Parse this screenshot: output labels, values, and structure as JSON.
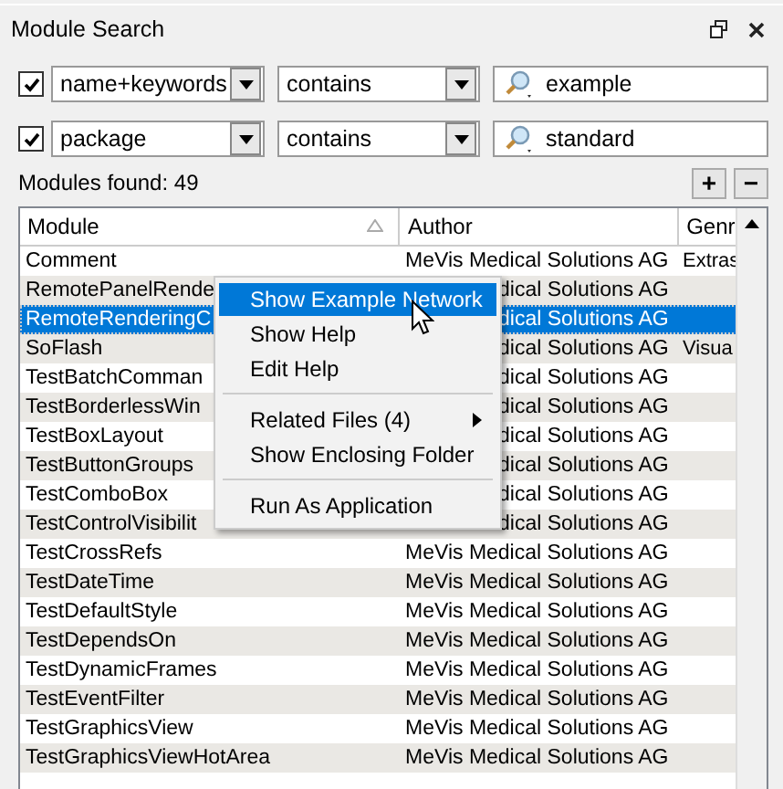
{
  "panel": {
    "title": "Module Search"
  },
  "filters": [
    {
      "checked": true,
      "field": "name+keywords",
      "operator": "contains",
      "value": "example"
    },
    {
      "checked": true,
      "field": "package",
      "operator": "contains",
      "value": "standard"
    }
  ],
  "result_count": "Modules found: 49",
  "buttons": [
    "+",
    "−"
  ],
  "table": {
    "columns": [
      {
        "label": "Module",
        "sorted": true
      },
      {
        "label": "Author",
        "sorted": false
      },
      {
        "label": "Genr",
        "sorted": false
      }
    ],
    "rows": [
      {
        "module": "Comment",
        "author": "MeVis Medical Solutions AG",
        "genre": "Extras",
        "selected": false,
        "covered": false
      },
      {
        "module": "RemotePanelRende",
        "author": "dical Solutions AG",
        "selected": false,
        "covered": true
      },
      {
        "module": "RemoteRenderingC",
        "author": "dical Solutions AG",
        "selected": true,
        "covered": true
      },
      {
        "module": "SoFlash",
        "author": "dical Solutions AG",
        "genre": "Visua",
        "selected": false,
        "covered": true
      },
      {
        "module": "TestBatchComman",
        "author": "dical Solutions AG",
        "selected": false,
        "covered": true
      },
      {
        "module": "TestBorderlessWin",
        "author": "dical Solutions AG",
        "selected": false,
        "covered": true
      },
      {
        "module": "TestBoxLayout",
        "author": "dical Solutions AG",
        "selected": false,
        "covered": true
      },
      {
        "module": "TestButtonGroups",
        "author": "dical Solutions AG",
        "selected": false,
        "covered": true
      },
      {
        "module": "TestComboBox",
        "author": "dical Solutions AG",
        "selected": false,
        "covered": true
      },
      {
        "module": "TestControlVisibilit",
        "author": "dical Solutions AG",
        "selected": false,
        "covered": true
      },
      {
        "module": "TestCrossRefs",
        "author": "MeVis Medical Solutions AG",
        "selected": false,
        "covered": false
      },
      {
        "module": "TestDateTime",
        "author": "MeVis Medical Solutions AG",
        "selected": false,
        "covered": false
      },
      {
        "module": "TestDefaultStyle",
        "author": "MeVis Medical Solutions AG",
        "selected": false,
        "covered": false
      },
      {
        "module": "TestDependsOn",
        "author": "MeVis Medical Solutions AG",
        "selected": false,
        "covered": false
      },
      {
        "module": "TestDynamicFrames",
        "author": "MeVis Medical Solutions AG",
        "selected": false,
        "covered": false
      },
      {
        "module": "TestEventFilter",
        "author": "MeVis Medical Solutions AG",
        "selected": false,
        "covered": false
      },
      {
        "module": "TestGraphicsView",
        "author": "MeVis Medical Solutions AG",
        "selected": false,
        "covered": false
      },
      {
        "module": "TestGraphicsViewHotArea",
        "author": "MeVis Medical Solutions AG",
        "selected": false,
        "covered": false
      }
    ]
  },
  "context_menu": [
    {
      "kind": "item",
      "label": "Show Example Network",
      "selected": true
    },
    {
      "kind": "item",
      "label": "Show Help",
      "selected": false
    },
    {
      "kind": "item",
      "label": "Edit Help",
      "selected": false
    },
    {
      "kind": "separator"
    },
    {
      "kind": "submenu",
      "label": "Related Files (4)",
      "selected": false
    },
    {
      "kind": "item",
      "label": "Show Enclosing Folder",
      "selected": false
    },
    {
      "kind": "separator"
    },
    {
      "kind": "item",
      "label": "Run As Application",
      "selected": false
    }
  ]
}
